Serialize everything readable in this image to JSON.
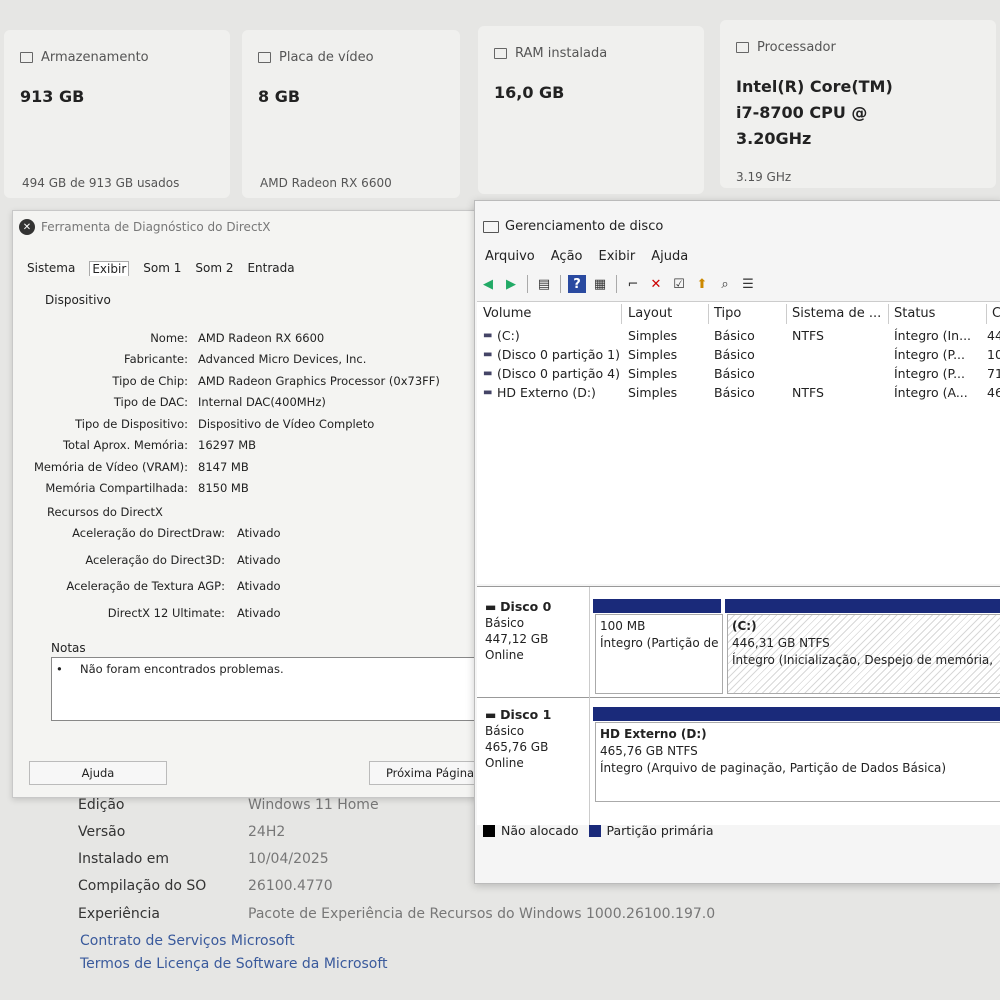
{
  "specs": [
    {
      "label": "Armazenamento",
      "value": "913 GB",
      "sub": "494 GB de 913 GB usados"
    },
    {
      "label": "Placa de vídeo",
      "value": "8 GB",
      "sub": "AMD Radeon RX 6600"
    },
    {
      "label": "RAM instalada",
      "value": "16,0 GB",
      "sub": ""
    },
    {
      "label": "Processador",
      "value_lines": [
        "Intel(R) Core(TM)",
        "i7-8700 CPU @",
        "3.20GHz"
      ],
      "sub": "3.19 GHz"
    }
  ],
  "about": {
    "rows": [
      {
        "k": "Edição",
        "v": "Windows 11 Home"
      },
      {
        "k": "Versão",
        "v": "24H2"
      },
      {
        "k": "Instalado em",
        "v": "10/04/2025"
      },
      {
        "k": "Compilação do SO",
        "v": "26100.4770"
      },
      {
        "k": "Experiência",
        "v": "Pacote de Experiência de Recursos do Windows 1000.26100.197.0"
      }
    ],
    "links": [
      "Contrato de Serviços Microsoft",
      "Termos de Licença de Software da Microsoft"
    ]
  },
  "dxdiag": {
    "title": "Ferramenta de Diagnóstico do DirectX",
    "tabs": [
      "Sistema",
      "Exibir",
      "Som 1",
      "Som 2",
      "Entrada"
    ],
    "group": "Dispositivo",
    "device": [
      {
        "k": "Nome:",
        "v": "AMD Radeon RX 6600"
      },
      {
        "k": "Fabricante:",
        "v": "Advanced Micro Devices, Inc."
      },
      {
        "k": "Tipo de Chip:",
        "v": "AMD Radeon Graphics Processor (0x73FF)"
      },
      {
        "k": "Tipo de DAC:",
        "v": "Internal DAC(400MHz)"
      },
      {
        "k": "Tipo de Dispositivo:",
        "v": "Dispositivo de Vídeo Completo"
      },
      {
        "k": "Total Aprox. Memória:",
        "v": "16297 MB"
      },
      {
        "k": "Memória de Vídeo (VRAM):",
        "v": "8147 MB"
      },
      {
        "k": "Memória Compartilhada:",
        "v": "8150 MB"
      }
    ],
    "resources_label": "Recursos do DirectX",
    "resources": [
      {
        "k": "Aceleração do DirectDraw:",
        "v": "Ativado"
      },
      {
        "k": "Aceleração do Direct3D:",
        "v": "Ativado"
      },
      {
        "k": "Aceleração de Textura AGP:",
        "v": "Ativado"
      },
      {
        "k": "DirectX 12 Ultimate:",
        "v": "Ativado"
      }
    ],
    "notes_label": "Notas",
    "note": "Não foram encontrados problemas.",
    "help_button": "Ajuda",
    "next_button": "Próxima Página"
  },
  "diskmgmt": {
    "title": "Gerenciamento de disco",
    "menu": [
      "Arquivo",
      "Ação",
      "Exibir",
      "Ajuda"
    ],
    "columns": [
      "Volume",
      "Layout",
      "Tipo",
      "Sistema de ...",
      "Status",
      "Ca"
    ],
    "volumes": [
      {
        "volume": "(C:)",
        "layout": "Simples",
        "tipo": "Básico",
        "fs": "NTFS",
        "status": "Íntegro (In...",
        "cap": "44"
      },
      {
        "volume": "(Disco 0 partição 1)",
        "layout": "Simples",
        "tipo": "Básico",
        "fs": "",
        "status": "Íntegro (P...",
        "cap": "10"
      },
      {
        "volume": "(Disco 0 partição 4)",
        "layout": "Simples",
        "tipo": "Básico",
        "fs": "",
        "status": "Íntegro (P...",
        "cap": "71"
      },
      {
        "volume": "HD Externo (D:)",
        "layout": "Simples",
        "tipo": "Básico",
        "fs": "NTFS",
        "status": "Íntegro (A...",
        "cap": "46"
      }
    ],
    "disks": [
      {
        "name": "Disco 0",
        "type": "Básico",
        "size": "447,12 GB",
        "state": "Online",
        "parts": [
          {
            "title": "",
            "size": "100 MB",
            "status": "Íntegro (Partição de"
          },
          {
            "title": "(C:)",
            "size": "446,31 GB NTFS",
            "status": "Íntegro (Inicialização, Despejo de memória,"
          }
        ]
      },
      {
        "name": "Disco 1",
        "type": "Básico",
        "size": "465,76 GB",
        "state": "Online",
        "parts": [
          {
            "title": "HD Externo  (D:)",
            "size": "465,76 GB NTFS",
            "status": "Íntegro (Arquivo de paginação, Partição de Dados Básica)"
          }
        ]
      }
    ],
    "legend": [
      "Não alocado",
      "Partição primária"
    ]
  },
  "colors": {
    "primary_partition": "#1a2a7a",
    "unallocated": "#000000",
    "link": "#3a5a9c"
  }
}
